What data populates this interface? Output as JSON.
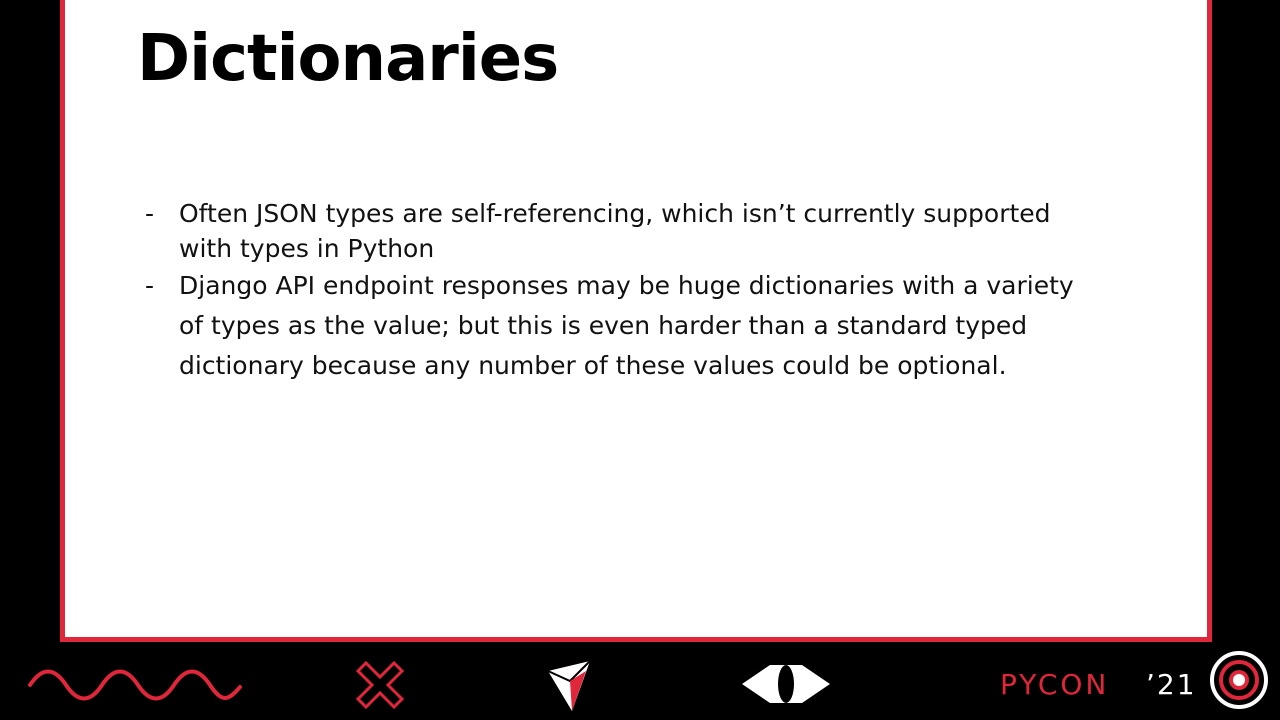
{
  "slide": {
    "title": "Dictionaries",
    "bullets": [
      {
        "marker": "-",
        "text": "Often JSON types are self-referencing, which isn’t currently supported with types in Python"
      },
      {
        "marker": "-",
        "text": "Django API endpoint responses may be huge dictionaries with a variety of types as the value; but this is even harder than a standard typed dictionary because any number of these values could be optional."
      }
    ]
  },
  "footer": {
    "brand": "PYCON",
    "year": "’21",
    "icons": [
      "wave-icon",
      "x-mark-icon",
      "paper-plane-icon",
      "eye-icon",
      "target-icon"
    ]
  },
  "colors": {
    "accent": "#e0263a",
    "background": "#000000",
    "slide": "#ffffff"
  }
}
